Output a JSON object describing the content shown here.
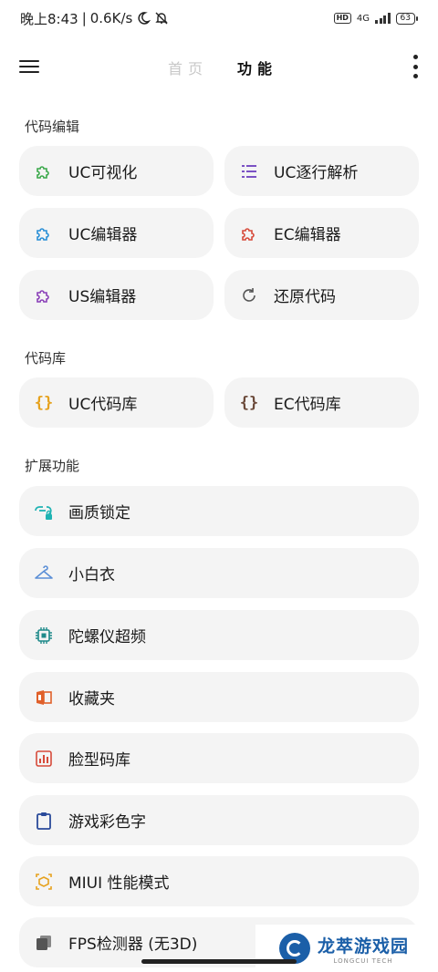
{
  "status_bar": {
    "time": "晚上8:43",
    "separator": "|",
    "net_speed": "0.6K/s",
    "hd": "HD",
    "network": "4G",
    "battery": "63"
  },
  "header": {
    "tabs": [
      {
        "label": "首页",
        "active": false
      },
      {
        "label": "功能",
        "active": true
      }
    ]
  },
  "sections": [
    {
      "title": "代码编辑",
      "items": [
        {
          "label": "UC可视化",
          "icon": "puzzle-icon",
          "color": "#3aa84a"
        },
        {
          "label": "UC逐行解析",
          "icon": "list-icon",
          "color": "#7b52c4"
        },
        {
          "label": "UC编辑器",
          "icon": "puzzle-icon",
          "color": "#2a8fd6"
        },
        {
          "label": "EC编辑器",
          "icon": "puzzle-icon",
          "color": "#d64a3a"
        },
        {
          "label": "US编辑器",
          "icon": "puzzle-icon",
          "color": "#8a3fb8"
        },
        {
          "label": "还原代码",
          "icon": "refresh-icon",
          "color": "#555555"
        }
      ]
    },
    {
      "title": "代码库",
      "items": [
        {
          "label": "UC代码库",
          "icon": "braces-icon",
          "color": "#e6a21e"
        },
        {
          "label": "EC代码库",
          "icon": "braces-icon",
          "color": "#6b4a3a"
        }
      ]
    },
    {
      "title": "扩展功能",
      "items": [
        {
          "label": "画质锁定",
          "icon": "link-lock-icon",
          "color": "#1fb3b3"
        },
        {
          "label": "小白衣",
          "icon": "hanger-icon",
          "color": "#5b8fd6"
        },
        {
          "label": "陀螺仪超频",
          "icon": "chip-icon",
          "color": "#1f8a8a"
        },
        {
          "label": "收藏夹",
          "icon": "office-icon",
          "color": "#e0602a"
        },
        {
          "label": "脸型码库",
          "icon": "bar-chart-icon",
          "color": "#d64a3a"
        },
        {
          "label": "游戏彩色字",
          "icon": "clipboard-icon",
          "color": "#2a4a9a"
        },
        {
          "label": "MIUI 性能模式",
          "icon": "box-icon",
          "color": "#e6a21e"
        },
        {
          "label": "FPS检测器 (无3D)",
          "icon": "copy-icon",
          "color": "#555555"
        }
      ]
    }
  ],
  "watermark": {
    "title": "龙萃游戏园",
    "subtitle": "LONGCUI TECH"
  }
}
